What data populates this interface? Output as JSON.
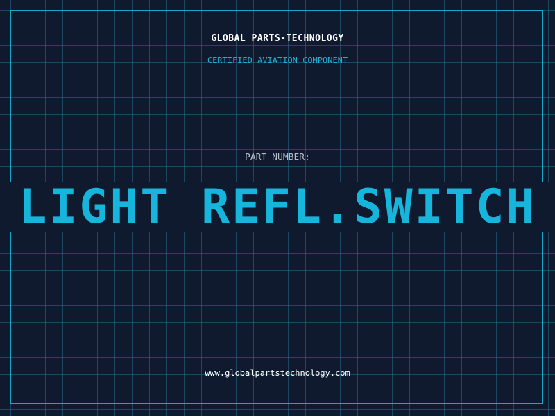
{
  "brand": {
    "name": "GLOBAL PARTS-TECHNOLOGY",
    "tagline": "CERTIFIED AVIATION COMPONENT"
  },
  "part": {
    "label": "PART NUMBER:",
    "name": "LIGHT REFL.SWITCH"
  },
  "footer": {
    "website": "www.globalpartstechnology.com"
  },
  "colors": {
    "background": "#0f1a2e",
    "grid": "#286e8c",
    "accent": "#16b6dc",
    "text": "#ffffff",
    "label": "#b4bcc8"
  }
}
